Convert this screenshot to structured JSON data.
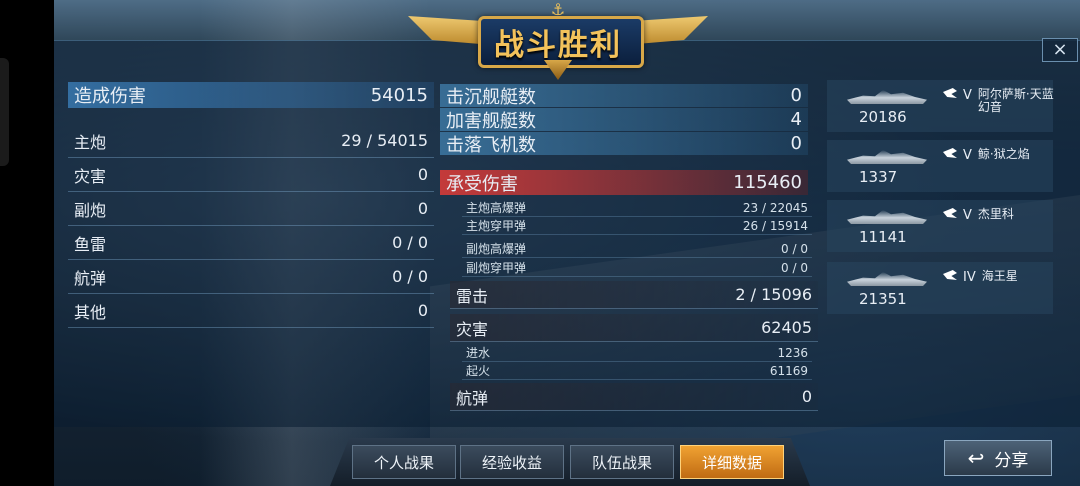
{
  "banner": {
    "title": "战斗胜利"
  },
  "left_stats": {
    "header": {
      "label": "造成伤害",
      "value": "54015"
    },
    "rows": [
      {
        "label": "主炮",
        "value": "29 / 54015"
      },
      {
        "label": "灾害",
        "value": "0"
      },
      {
        "label": "副炮",
        "value": "0"
      },
      {
        "label": "鱼雷",
        "value": "0 / 0"
      },
      {
        "label": "航弹",
        "value": "0 / 0"
      },
      {
        "label": "其他",
        "value": "0"
      }
    ]
  },
  "kills": [
    {
      "label": "击沉舰艇数",
      "value": "0"
    },
    {
      "label": "加害舰艇数",
      "value": "4"
    },
    {
      "label": "击落飞机数",
      "value": "0"
    }
  ],
  "received": {
    "header": {
      "label": "承受伤害",
      "value": "115460"
    },
    "main_sub": [
      {
        "label": "主炮高爆弹",
        "value": "23 / 22045"
      },
      {
        "label": "主炮穿甲弹",
        "value": "26 / 15914"
      }
    ],
    "sec_sub": [
      {
        "label": "副炮高爆弹",
        "value": "0 / 0"
      },
      {
        "label": "副炮穿甲弹",
        "value": "0 / 0"
      }
    ],
    "torpedo": {
      "label": "雷击",
      "value": "2 / 15096"
    },
    "disaster": {
      "label": "灾害",
      "value": "62405"
    },
    "disaster_sub": [
      {
        "label": "进水",
        "value": "1236"
      },
      {
        "label": "起火",
        "value": "61169"
      }
    ],
    "bomb": {
      "label": "航弹",
      "value": "0"
    }
  },
  "ships": [
    {
      "damage": "20186",
      "tier": "V",
      "name": "阿尔萨斯·天蓝幻音",
      "icon": "ship-class-icon"
    },
    {
      "damage": "1337",
      "tier": "V",
      "name": "鲸·狱之焰",
      "icon": "ship-class-icon"
    },
    {
      "damage": "11141",
      "tier": "V",
      "name": "杰里科",
      "icon": "ship-class-icon"
    },
    {
      "damage": "21351",
      "tier": "IV",
      "name": "海王星",
      "icon": "ship-class-icon"
    }
  ],
  "tabs": [
    "个人战果",
    "经验收益",
    "队伍战果",
    "详细数据"
  ],
  "active_tab": "详细数据",
  "share": {
    "label": "分享"
  },
  "close_icon": "×",
  "colors": {
    "gold": "#f3c25b",
    "tab_active": "#f0a232",
    "damage_red": "#c43a3a"
  }
}
